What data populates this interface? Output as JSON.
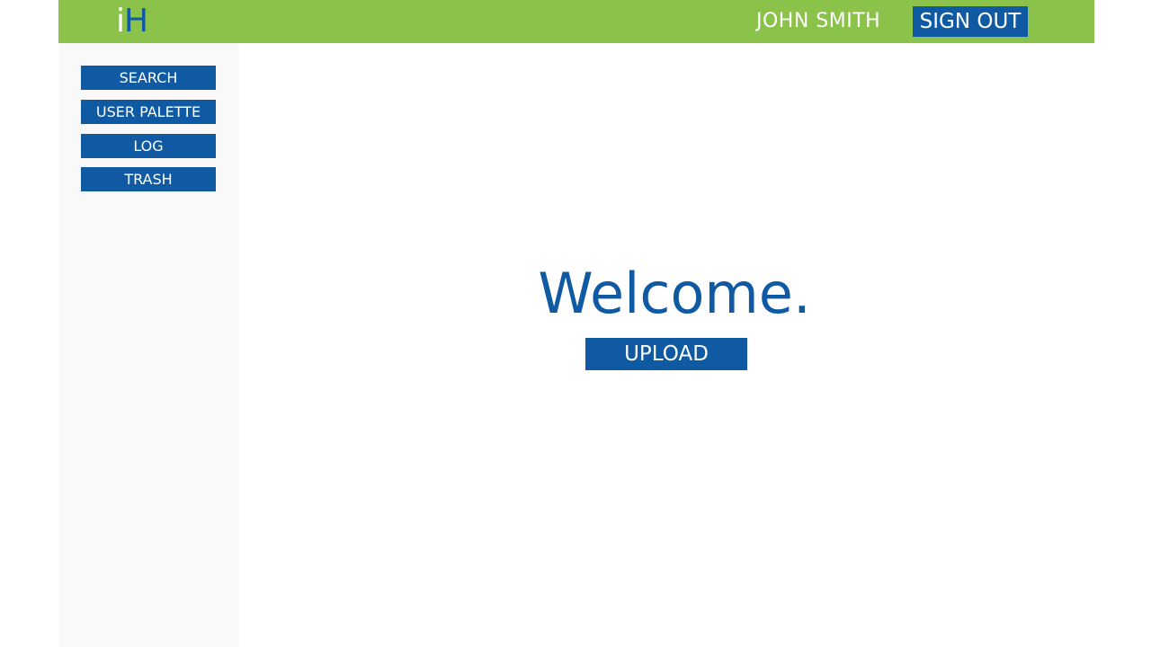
{
  "header": {
    "logo": {
      "part1": "i",
      "part2": "H"
    },
    "user_name": "JOHN SMITH",
    "signout_label": "SIGN OUT"
  },
  "sidebar": {
    "items": [
      {
        "label": "SEARCH"
      },
      {
        "label": "USER PALETTE"
      },
      {
        "label": "LOG"
      },
      {
        "label": "TRASH"
      }
    ]
  },
  "main": {
    "welcome": "Welcome.",
    "upload_label": "UPLOAD"
  },
  "colors": {
    "header_bg": "#8bc34a",
    "primary": "#0f5aa3",
    "sidebar_bg": "#f9f9f9",
    "text_on_primary": "#ffffff"
  }
}
